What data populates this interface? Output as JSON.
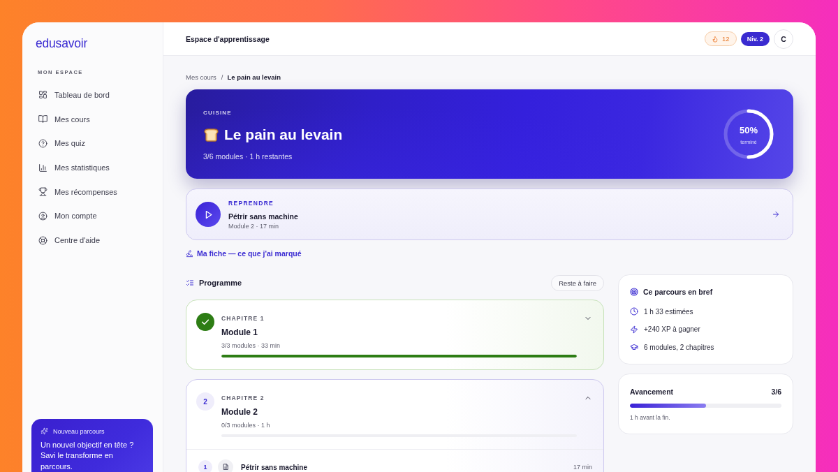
{
  "sidebar": {
    "logo": "edusavoir",
    "section_label": "MON ESPACE",
    "items": [
      {
        "label": "Tableau de bord",
        "selected": false
      },
      {
        "label": "Mes cours",
        "selected": false
      },
      {
        "label": "Mes quiz",
        "selected": false
      },
      {
        "label": "Mes statistiques",
        "selected": false
      },
      {
        "label": "Mes récompenses",
        "selected": false
      },
      {
        "label": "Mon compte",
        "selected": false
      },
      {
        "label": "Centre d'aide",
        "selected": false
      }
    ],
    "promo": {
      "title": "Nouveau parcours",
      "text": "Un nouvel objectif en tête ? Savi le transforme en parcours."
    }
  },
  "topbar": {
    "title": "Espace d'apprentissage",
    "streak": "12",
    "level": "Niv. 2",
    "avatar": "C"
  },
  "breadcrumb": {
    "parent": "Mes cours",
    "separator": "/",
    "current": "Le pain au levain"
  },
  "hero": {
    "category": "CUISINE",
    "title": "Le pain au levain",
    "subtitle": "3/6 modules · 1 h restantes",
    "progress": {
      "level": 0.5,
      "value": "50%",
      "caption": "terminé"
    }
  },
  "resume": {
    "label": "REPRENDRE",
    "title": "Pétrir sans machine",
    "meta": "Module 2 · 17 min"
  },
  "notes_link": "Ma fiche — ce que j'ai marqué",
  "programme": {
    "title": "Programme",
    "filter_button": "Reste à faire",
    "chapters": [
      {
        "kind": "done",
        "label": "CHAPITRE 1",
        "title": "Module 1",
        "meta": "3/3 modules · 33 min",
        "level": 1,
        "expanded": false
      },
      {
        "kind": "current",
        "number": "2",
        "label": "CHAPITRE 2",
        "title": "Module 2",
        "meta": "0/3 modules · 1 h",
        "level": 0,
        "expanded": true,
        "lessons": [
          {
            "number": "1",
            "title": "Pétrir sans machine",
            "duration": "17 min"
          }
        ]
      }
    ]
  },
  "summary": {
    "title": "Ce parcours en bref",
    "items": [
      "1 h 33 estimées",
      "+240 XP à gagner",
      "6 modules, 2 chapitres"
    ]
  },
  "progress_card": {
    "title": "Avancement",
    "count": "3/6",
    "level": 0.5,
    "note": "1 h avant la fin."
  }
}
